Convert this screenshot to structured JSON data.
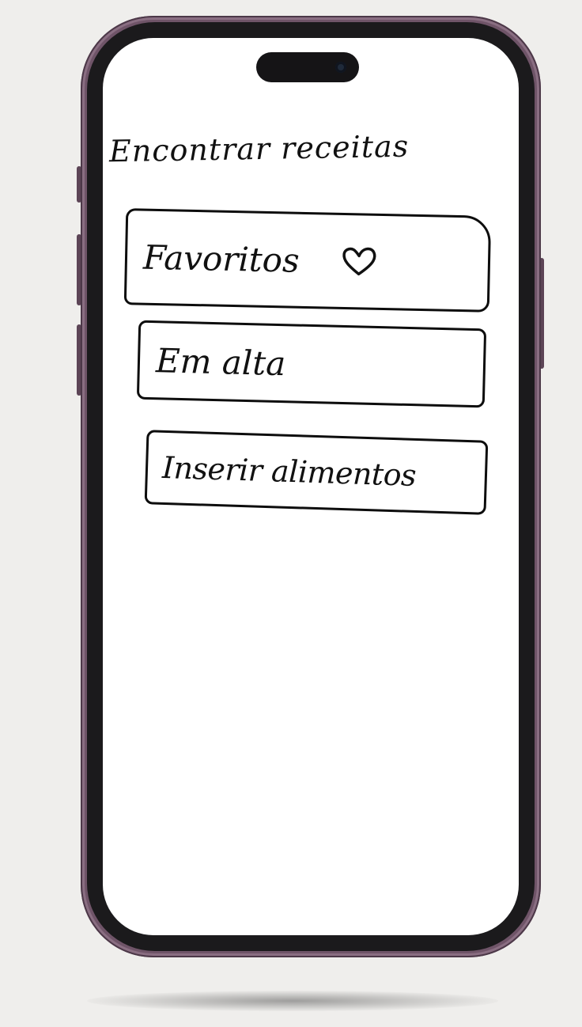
{
  "screen": {
    "title": "Encontrar receitas"
  },
  "menu": {
    "items": [
      {
        "label": "Favoritos",
        "icon": "heart-icon"
      },
      {
        "label": "Em alta"
      },
      {
        "label": "Inserir alimentos"
      }
    ]
  },
  "colors": {
    "frame": "#6f5468",
    "bezel": "#1b1a1c",
    "screen": "#ffffff",
    "ink": "#111111",
    "background": "#efeeec"
  }
}
